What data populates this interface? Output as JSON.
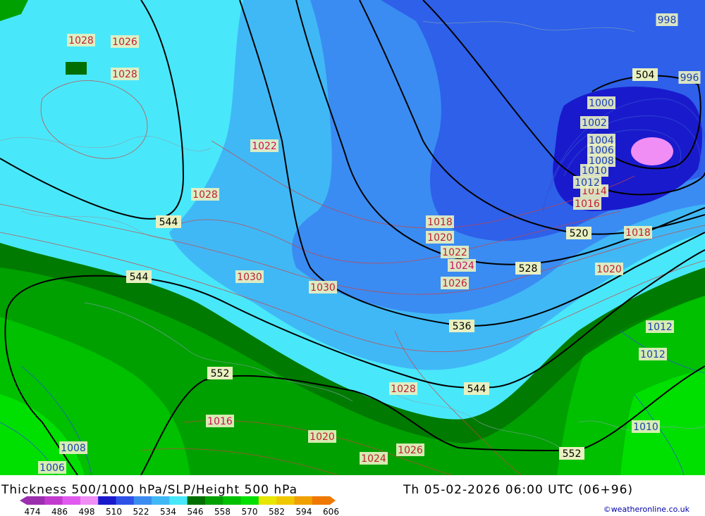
{
  "title": "Thickness 500/1000 hPa/SLP/Height 500 hPa",
  "valid_time": "Th 05-02-2026 06:00 UTC (06+96)",
  "credit": "©weatheronline.co.uk",
  "legend": {
    "ticks": [
      "474",
      "486",
      "498",
      "510",
      "522",
      "534",
      "546",
      "558",
      "570",
      "582",
      "594",
      "606"
    ],
    "colors": [
      "#9b2fae",
      "#c23bcf",
      "#e05af0",
      "#f08ef5",
      "#1a1acd",
      "#2e52e8",
      "#3a8cf2",
      "#40b8f6",
      "#48e8fa",
      "#006e00",
      "#00a000",
      "#00c000",
      "#00e000",
      "#e6e600",
      "#f0c800",
      "#f0a000",
      "#f07800"
    ]
  },
  "slp_labels": [
    {
      "text": "1028",
      "color": "#c02030"
    },
    {
      "text": "1026",
      "color": "#c02030"
    },
    {
      "text": "1028",
      "color": "#c02030"
    },
    {
      "text": "1022",
      "color": "#d01060"
    },
    {
      "text": "1028",
      "color": "#c02030"
    },
    {
      "text": "1030",
      "color": "#c02030"
    },
    {
      "text": "1030",
      "color": "#c02030"
    },
    {
      "text": "1018",
      "color": "#c02030"
    },
    {
      "text": "1020",
      "color": "#c02030"
    },
    {
      "text": "1022",
      "color": "#c02030"
    },
    {
      "text": "1024",
      "color": "#d01060"
    },
    {
      "text": "1026",
      "color": "#c02030"
    },
    {
      "text": "1028",
      "color": "#c02030"
    },
    {
      "text": "1016",
      "color": "#d01060"
    },
    {
      "text": "1020",
      "color": "#c02030"
    },
    {
      "text": "1024",
      "color": "#c02030"
    },
    {
      "text": "1026",
      "color": "#c02030"
    },
    {
      "text": "1018",
      "color": "#c02030"
    },
    {
      "text": "1020",
      "color": "#c02030"
    },
    {
      "text": "1014",
      "color": "#c02030"
    },
    {
      "text": "1016",
      "color": "#c02030"
    },
    {
      "text": "1012",
      "color": "#1a40b0"
    },
    {
      "text": "1012",
      "color": "#1a40b0"
    },
    {
      "text": "998",
      "color": "#1a40b0"
    },
    {
      "text": "996",
      "color": "#1a40b0"
    },
    {
      "text": "1000",
      "color": "#1a40b0"
    },
    {
      "text": "1002",
      "color": "#1a40b0"
    },
    {
      "text": "1004",
      "color": "#1a40b0"
    },
    {
      "text": "1006",
      "color": "#1a40b0"
    },
    {
      "text": "1008",
      "color": "#1a40b0"
    },
    {
      "text": "1010",
      "color": "#1a40b0"
    },
    {
      "text": "1012",
      "color": "#1a40b0"
    },
    {
      "text": "1010",
      "color": "#1a40b0"
    },
    {
      "text": "1008",
      "color": "#1a40b0"
    },
    {
      "text": "1006",
      "color": "#1a40b0"
    },
    {
      "text": "1006",
      "color": "#1a40b0"
    }
  ],
  "height_labels": [
    "504",
    "520",
    "528",
    "536",
    "544",
    "544",
    "544",
    "552",
    "552"
  ]
}
